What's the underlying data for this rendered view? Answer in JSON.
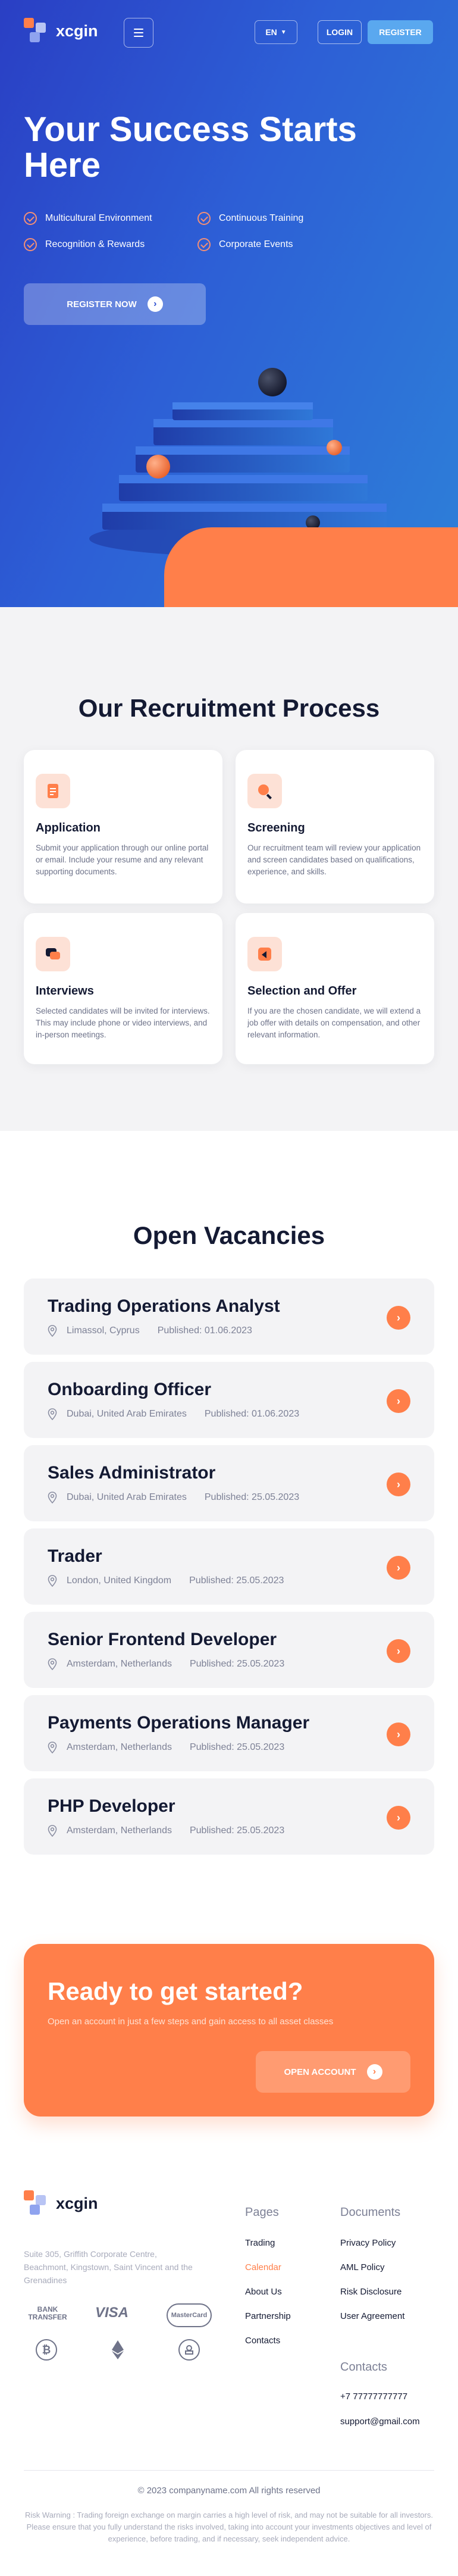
{
  "header": {
    "brand": "xcgin",
    "lang": "EN",
    "login_label": "LOGIN",
    "register_label": "REGISTER"
  },
  "hero": {
    "title": "Your Success Starts Here",
    "features": [
      "Multicultural Environment",
      "Continuous Training",
      "Recognition & Rewards",
      "Corporate Events"
    ],
    "cta_label": "REGISTER NOW"
  },
  "process": {
    "title": "Our Recruitment Process",
    "steps": [
      {
        "name": "Application",
        "desc": "Submit your application through our online portal or email. Include your resume and any relevant supporting documents.",
        "icon": "document-icon"
      },
      {
        "name": "Screening",
        "desc": "Our recruitment team will review your application and screen candidates based on qualifications, experience, and skills.",
        "icon": "magnifier-icon"
      },
      {
        "name": "Interviews",
        "desc": "Selected candidates will be invited for interviews. This may include phone or video interviews, and in-person meetings.",
        "icon": "chat-icon"
      },
      {
        "name": "Selection and Offer",
        "desc": "If you are the chosen candidate, we will extend a job offer with details on compensation, and other relevant information.",
        "icon": "offer-icon"
      }
    ]
  },
  "vacancies": {
    "title": "Open Vacancies",
    "items": [
      {
        "title": "Trading Operations Analyst",
        "location": "Limassol, Cyprus",
        "published": "Published: 01.06.2023"
      },
      {
        "title": "Onboarding Officer",
        "location": "Dubai, United Arab Emirates",
        "published": "Published: 01.06.2023"
      },
      {
        "title": "Sales Administrator",
        "location": "Dubai, United Arab Emirates",
        "published": "Published: 25.05.2023"
      },
      {
        "title": "Trader",
        "location": "London, United Kingdom",
        "published": "Published: 25.05.2023"
      },
      {
        "title": "Senior Frontend Developer",
        "location": "Amsterdam, Netherlands",
        "published": "Published: 25.05.2023"
      },
      {
        "title": "Payments Operations Manager",
        "location": "Amsterdam, Netherlands",
        "published": "Published: 25.05.2023"
      },
      {
        "title": "PHP Developer",
        "location": "Amsterdam, Netherlands",
        "published": "Published: 25.05.2023"
      }
    ]
  },
  "cta": {
    "title": "Ready to get started?",
    "subtitle": "Open an account in just a few steps and gain access to all asset classes",
    "button_label": "OPEN ACCOUNT"
  },
  "footer": {
    "brand": "xcgin",
    "address": "Suite 305, Griffith Corporate Centre, Beachmont, Kingstown, Saint Vincent and the Grenadines",
    "payments": [
      "BANK TRANSFER",
      "VISA",
      "MasterCard"
    ],
    "pages_title": "Pages",
    "pages": [
      "Trading",
      "Calendar",
      "About Us",
      "Partnership",
      "Contacts"
    ],
    "documents_title": "Documents",
    "documents": [
      "Privacy Policy",
      "AML Policy",
      "Risk Disclosure",
      "User Agreement"
    ],
    "contacts_title": "Contacts",
    "phone": "+7 77777777777",
    "email": "support@gmail.com",
    "copyright": "© 2023 companyname.com All rights reserved",
    "risk_warning": "Risk Warning : Trading foreign exchange on margin carries a high level of risk, and may not be suitable for all investors. Please ensure that you fully understand the risks involved, taking into account your investments objectives and level of experience, before trading, and if necessary, seek independent advice."
  },
  "colors": {
    "accent": "#ff7f4a",
    "hero_start": "#2a3fc4",
    "hero_end": "#2d80d8",
    "dark_text": "#141a33",
    "muted_text": "#6d7289",
    "active_link": "#ff7f4a"
  }
}
